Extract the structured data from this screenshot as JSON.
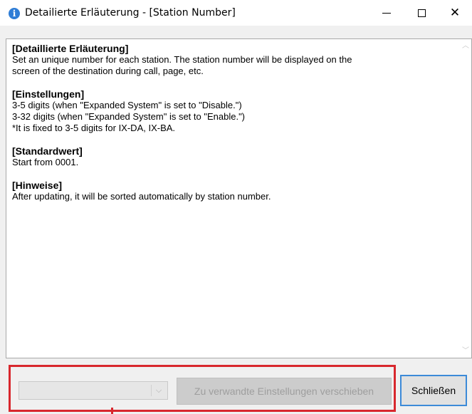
{
  "window": {
    "title": "Detailierte Erläuterung - [Station Number]",
    "title_icon": "info-icon"
  },
  "titlebar_controls": {
    "minimize_icon": "minimize-icon",
    "maximize_icon": "maximize-icon",
    "close_glyph": "✕"
  },
  "content": {
    "sections": [
      {
        "heading": "[Detaillierte Erläuterung]",
        "lines": [
          "Set an unique number for each station. The station number will be displayed on the",
          "screen of the destination during call, page, etc."
        ]
      },
      {
        "heading": "[Einstellungen]",
        "lines": [
          "3-5 digits (when \"Expanded System\" is set to \"Disable.\")",
          "3-32 digits (when \"Expanded System\" is set to \"Enable.\")",
          "*It is fixed to 3-5 digits for IX-DA, IX-BA."
        ]
      },
      {
        "heading": "[Standardwert]",
        "lines": [
          "Start from 0001."
        ]
      },
      {
        "heading": "[Hinweise]",
        "lines": [
          "After updating, it will be sorted automatically by station number."
        ]
      }
    ]
  },
  "footer": {
    "combo_value": "",
    "combo_arrow": "⌵",
    "related_button_label": "Zu verwandte Einstellungen verschieben",
    "close_button_label": "Schließen",
    "highlight_color": "#d8272d",
    "focus_color": "#3c8ad8"
  }
}
